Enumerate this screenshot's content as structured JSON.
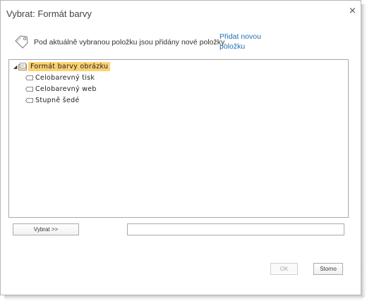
{
  "dialog": {
    "title": "Vybrat: Formát barvy",
    "close_glyph": "×",
    "info_text": "Pod aktuálně vybranou položku jsou přidány nové položky.",
    "add_link_line1": "Přidat novou",
    "add_link_line2": "položku",
    "icons": {
      "info": "tag-icon",
      "close": "close-icon",
      "expander": "collapse-triangle-icon",
      "root": "folder-icon",
      "leaf": "term-tag-icon"
    }
  },
  "tree": {
    "expander_glyph": "◢",
    "root_label": "Formát barvy obrázku",
    "items": [
      "Celobarevný tisk",
      "Celobarevný web",
      "Stupně šedé"
    ]
  },
  "footer": {
    "select_label": "Vybrat >>",
    "selection_value": "",
    "ok_label": "OK",
    "cancel_label": "Storno"
  },
  "colors": {
    "highlight": "#fcd171",
    "link": "#1f6fb5"
  }
}
